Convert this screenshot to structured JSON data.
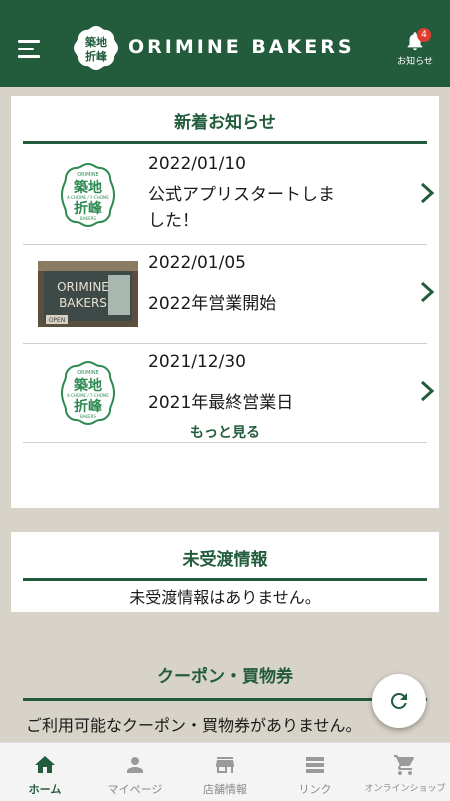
{
  "header": {
    "brand": "ORIMINE BAKERS",
    "notification_count": "4",
    "notification_label": "お知らせ"
  },
  "news": {
    "title": "新着お知らせ",
    "items": [
      {
        "date": "2022/01/10",
        "title": "公式アプリスタートしました！",
        "thumb": "logo-seal"
      },
      {
        "date": "2022/01/05",
        "title": "2022年営業開始",
        "thumb": "storefront-photo"
      },
      {
        "date": "2021/12/30",
        "title": "2021年最終営業日",
        "thumb": "logo-seal"
      }
    ],
    "more_label": "もっと見る"
  },
  "undelivered": {
    "title": "未受渡情報",
    "empty_message": "未受渡情報はありません。"
  },
  "coupons": {
    "title": "クーポン・買物券",
    "empty_message": "ご利用可能なクーポン・買物券がありません。"
  },
  "logo_text": {
    "top": "ORIMINE",
    "kanji1": "築地",
    "kanji2": "折峰",
    "sub": "4-CHOME / 7-CHOME",
    "bottom": "BAKERS"
  },
  "storefront_text": {
    "line1": "ORIMINE",
    "line2": "BAKERS",
    "sign": "OPEN"
  },
  "bottom_nav": [
    {
      "label": "ホーム",
      "icon": "home-icon",
      "active": true
    },
    {
      "label": "マイページ",
      "icon": "person-icon",
      "active": false
    },
    {
      "label": "店舗情報",
      "icon": "store-icon",
      "active": false
    },
    {
      "label": "リンク",
      "icon": "list-icon",
      "active": false
    },
    {
      "label": "オンラインショップ",
      "icon": "cart-icon",
      "active": false
    }
  ],
  "colors": {
    "primary": "#235c3c",
    "badge": "#e23a2e",
    "background": "#d8d3c9"
  }
}
